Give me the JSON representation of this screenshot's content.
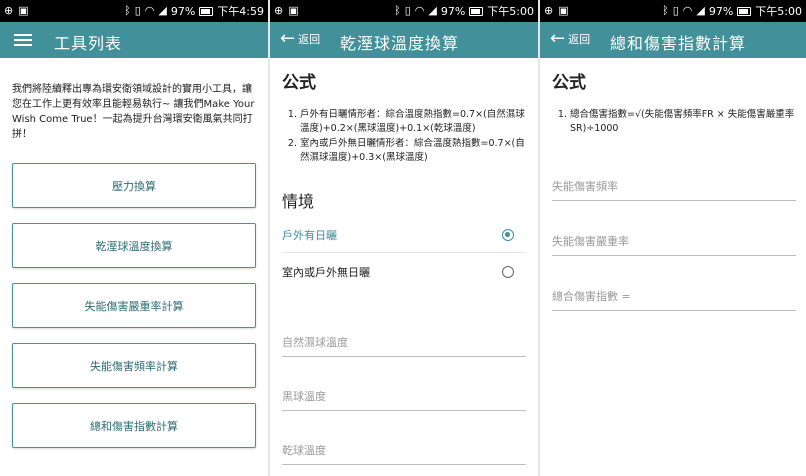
{
  "status": {
    "screen1": {
      "battery": "97%",
      "time": "下午4:59"
    },
    "screen2": {
      "battery": "97%",
      "time": "下午5:00"
    },
    "screen3": {
      "battery": "97%",
      "time": "下午5:00"
    }
  },
  "screen1": {
    "title": "工具列表",
    "intro": "我們將陸續釋出專為環安衛領域設計的實用小工具，讓您在工作上更有效率且能輕易執行~ 讓我們Make Your Wish Come True！一起為提升台灣環安衛風氣共同打拼！",
    "tools": [
      "壓力換算",
      "乾溼球溫度換算",
      "失能傷害嚴重率計算",
      "失能傷害頻率計算",
      "總和傷害指數計算"
    ]
  },
  "screen2": {
    "back_label": "返回",
    "title": "乾溼球溫度換算",
    "formula_heading": "公式",
    "formulas": [
      "戶外有日曬情形者：綜合溫度熱指數=0.7×(自然濕球溫度)+0.2×(黑球溫度)+0.1×(乾球溫度)",
      "室內或戶外無日曬情形者：綜合溫度熱指數=0.7×(自然濕球溫度)+0.3×(黑球溫度)"
    ],
    "situation_heading": "情境",
    "options": [
      "戶外有日曬",
      "室內或戶外無日曬"
    ],
    "selected_option": "戶外有日曬",
    "fields": [
      "自然濕球溫度",
      "黑球溫度",
      "乾球溫度"
    ]
  },
  "screen3": {
    "back_label": "返回",
    "title": "總和傷害指數計算",
    "formula_heading": "公式",
    "formulas": [
      "總合傷害指數=√(失能傷害頻率FR × 失能傷害嚴重率SR)÷1000"
    ],
    "fields": [
      "失能傷害頻率",
      "失能傷害嚴重率",
      "總合傷害指數 ="
    ]
  },
  "colors": {
    "appbar": "#42909a",
    "accent": "#3d8e98",
    "status_bar": "#000000"
  }
}
